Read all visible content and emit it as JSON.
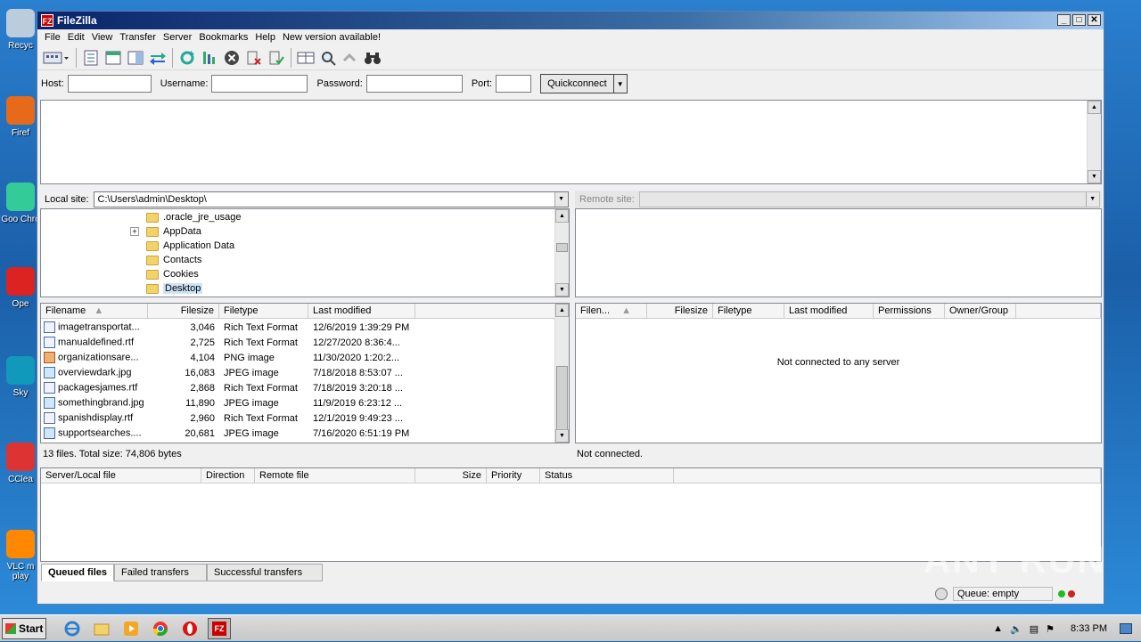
{
  "desktop": {
    "icons": [
      {
        "label": "Recyc",
        "color": "#bcd"
      },
      {
        "label": "Firef",
        "color": "#e66a1a"
      },
      {
        "label": "Goo Chro",
        "color": "#3c9"
      },
      {
        "label": "Ope",
        "color": "#d22"
      },
      {
        "label": "Sky",
        "color": "#19b"
      },
      {
        "label": "CClea",
        "color": "#d33"
      },
      {
        "label": "VLC m play",
        "color": "#f80"
      }
    ]
  },
  "window": {
    "title": "FileZilla",
    "logo": "FZ",
    "controls": {
      "minimize": "_",
      "maximize": "□",
      "close": "✕"
    }
  },
  "menu": [
    "File",
    "Edit",
    "View",
    "Transfer",
    "Server",
    "Bookmarks",
    "Help",
    "New version available!"
  ],
  "toolbar_icons": [
    "site-manager",
    "toggle-log",
    "toggle-local-tree",
    "toggle-remote-tree",
    "toggle-queue",
    "refresh",
    "process-queue",
    "cancel",
    "disconnect",
    "reconnect",
    "dir-compare",
    "sync-browse",
    "search",
    "find"
  ],
  "quickconnect": {
    "host_label": "Host:",
    "username_label": "Username:",
    "password_label": "Password:",
    "port_label": "Port:",
    "button": "Quickconnect",
    "host_value": "",
    "username_value": "",
    "password_value": "",
    "port_value": ""
  },
  "local": {
    "label": "Local site:",
    "path": "C:\\Users\\admin\\Desktop\\",
    "tree": [
      {
        "name": ".oracle_jre_usage",
        "expander": ""
      },
      {
        "name": "AppData",
        "expander": "+"
      },
      {
        "name": "Application Data",
        "expander": ""
      },
      {
        "name": "Contacts",
        "expander": ""
      },
      {
        "name": "Cookies",
        "expander": ""
      },
      {
        "name": "Desktop",
        "expander": ""
      }
    ],
    "columns": [
      "Filename",
      "Filesize",
      "Filetype",
      "Last modified"
    ],
    "files": [
      {
        "name": "imagetransportat...",
        "size": "3,046",
        "type": "Rich Text Format",
        "modified": "12/6/2019 1:39:29 PM",
        "kind": "rtf"
      },
      {
        "name": "manualdefined.rtf",
        "size": "2,725",
        "type": "Rich Text Format",
        "modified": "12/27/2020 8:36:4...",
        "kind": "rtf"
      },
      {
        "name": "organizationsare...",
        "size": "4,104",
        "type": "PNG image",
        "modified": "11/30/2020 1:20:2...",
        "kind": "png"
      },
      {
        "name": "overviewdark.jpg",
        "size": "16,083",
        "type": "JPEG image",
        "modified": "7/18/2018 8:53:07 ...",
        "kind": "img"
      },
      {
        "name": "packagesjames.rtf",
        "size": "2,868",
        "type": "Rich Text Format",
        "modified": "7/18/2019 3:20:18 ...",
        "kind": "rtf"
      },
      {
        "name": "somethingbrand.jpg",
        "size": "11,890",
        "type": "JPEG image",
        "modified": "11/9/2019 6:23:12 ...",
        "kind": "img"
      },
      {
        "name": "spanishdisplay.rtf",
        "size": "2,960",
        "type": "Rich Text Format",
        "modified": "12/1/2019 9:49:23 ...",
        "kind": "rtf"
      },
      {
        "name": "supportsearches....",
        "size": "20,681",
        "type": "JPEG image",
        "modified": "7/16/2020 6:51:19 PM",
        "kind": "img"
      }
    ],
    "status": "13 files. Total size: 74,806 bytes"
  },
  "remote": {
    "label": "Remote site:",
    "columns": [
      "Filen...",
      "Filesize",
      "Filetype",
      "Last modified",
      "Permissions",
      "Owner/Group"
    ],
    "empty_message": "Not connected to any server",
    "status": "Not connected."
  },
  "queue": {
    "columns": [
      "Server/Local file",
      "Direction",
      "Remote file",
      "Size",
      "Priority",
      "Status"
    ],
    "tabs": [
      "Queued files",
      "Failed transfers",
      "Successful transfers"
    ],
    "status": "Queue: empty"
  },
  "watermark": "ANY RUN",
  "taskbar": {
    "start": "Start",
    "apps": [
      "ie-icon",
      "explorer-icon",
      "media-player-icon",
      "chrome-icon",
      "opera-icon",
      "filezilla-icon"
    ],
    "clock": "8:33 PM"
  }
}
